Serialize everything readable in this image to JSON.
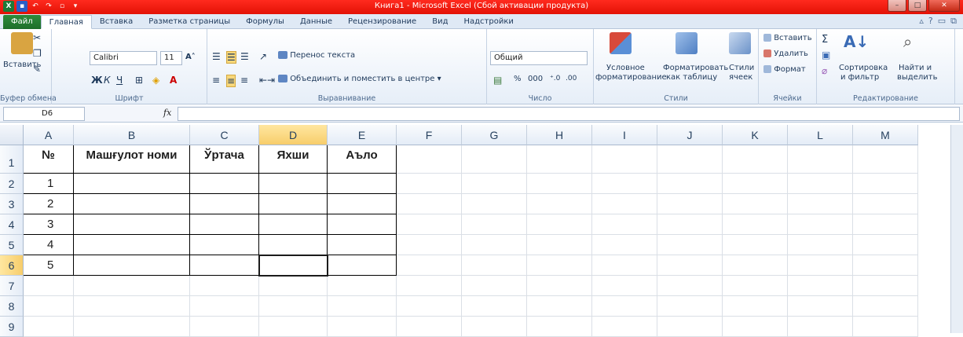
{
  "window": {
    "title": "Книга1  -  Microsoft Excel (Сбой активации продукта)",
    "min": "–",
    "max": "□",
    "close": "✕"
  },
  "tabs": [
    "Файл",
    "Главная",
    "Вставка",
    "Разметка страницы",
    "Формулы",
    "Данные",
    "Рецензирование",
    "Вид",
    "Надстройки"
  ],
  "active_tab": "Главная",
  "ribbon": {
    "clipboard": {
      "paste": "Вставить",
      "label": "Буфер обмена"
    },
    "font": {
      "name": "Calibri",
      "size": "11",
      "bold": "Ж",
      "italic": "К",
      "underline": "Ч",
      "label": "Шрифт"
    },
    "alignment": {
      "wrap": "Перенос текста",
      "merge": "Объединить и поместить в центре",
      "label": "Выравнивание"
    },
    "number": {
      "format": "Общий",
      "percent": "%",
      "thousands": "000",
      "label": "Число"
    },
    "styles": {
      "conditional_1": "Условное",
      "conditional_2": "форматирование",
      "table_1": "Форматировать",
      "table_2": "как таблицу",
      "cell_1": "Стили",
      "cell_2": "ячеек",
      "label": "Стили"
    },
    "cells": {
      "insert": "Вставить",
      "delete": "Удалить",
      "format": "Формат",
      "label": "Ячейки"
    },
    "editing": {
      "sort_1": "Сортировка",
      "sort_2": "и фильтр",
      "find_1": "Найти и",
      "find_2": "выделить",
      "label": "Редактирование"
    }
  },
  "formula_bar": {
    "name_box": "D6",
    "fx": "fx",
    "value": ""
  },
  "columns": [
    "A",
    "B",
    "C",
    "D",
    "E",
    "F",
    "G",
    "H",
    "I",
    "J",
    "K",
    "L",
    "M"
  ],
  "rows": [
    "1",
    "2",
    "3",
    "4",
    "5",
    "6",
    "7",
    "8",
    "9"
  ],
  "selected_cell": "D6",
  "table": {
    "headers": [
      "№",
      "Машғулот номи",
      "Ўртача",
      "Яхши",
      "Аъло"
    ],
    "numbers": [
      "1",
      "2",
      "3",
      "4",
      "5"
    ]
  }
}
